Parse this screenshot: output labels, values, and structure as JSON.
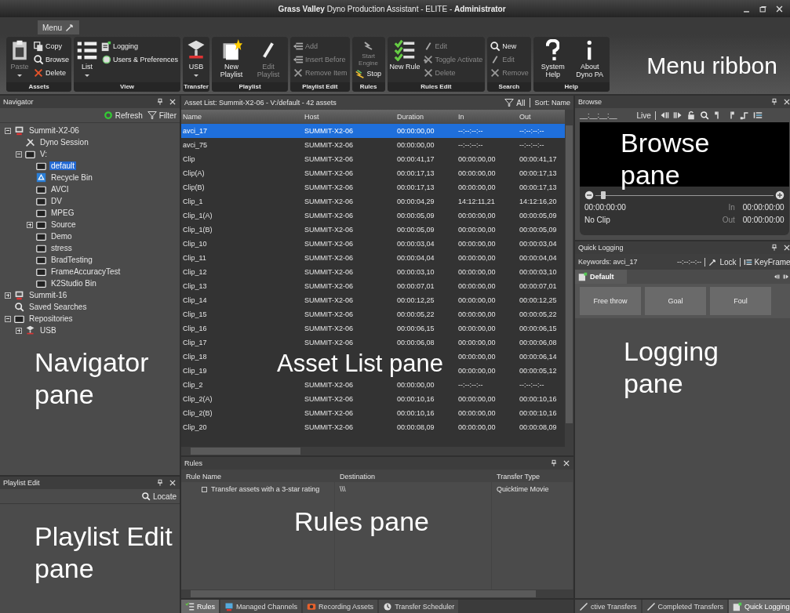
{
  "window": {
    "title": "**Grass Valley** Dyno Production Assistant - ELITE - **Administrator**"
  },
  "menu_tab": {
    "label": "Menu"
  },
  "ribbon": {
    "groups": [
      {
        "label": "Assets",
        "items": [
          {
            "label": "Paste",
            "kind": "large",
            "disabled": true,
            "dropdown": true
          },
          {
            "label": "Copy",
            "kind": "small",
            "disabled": false
          },
          {
            "label": "Browse",
            "kind": "small",
            "disabled": false
          },
          {
            "label": "Delete",
            "kind": "small",
            "disabled": false
          }
        ]
      },
      {
        "label": "View",
        "items": [
          {
            "label": "List",
            "kind": "large",
            "disabled": false,
            "dropdown": true
          },
          {
            "label": "Logging",
            "kind": "small",
            "disabled": false
          },
          {
            "label": "Users & Preferences",
            "kind": "small",
            "disabled": false
          }
        ]
      },
      {
        "label": "Transfer",
        "items": [
          {
            "label": "USB",
            "kind": "large",
            "disabled": false,
            "dropdown": true
          }
        ]
      },
      {
        "label": "Playlist",
        "items": [
          {
            "label": "New Playlist",
            "kind": "large",
            "disabled": false
          },
          {
            "label": "Edit Playlist",
            "kind": "large",
            "disabled": true
          }
        ]
      },
      {
        "label": "Playlist Edit",
        "items": [
          {
            "label": "Add",
            "kind": "small",
            "disabled": true
          },
          {
            "label": "Insert Before",
            "kind": "small",
            "disabled": true
          },
          {
            "label": "Remove Item",
            "kind": "small",
            "disabled": true
          }
        ]
      },
      {
        "label": "Rules",
        "items": [
          {
            "label": "Start Engine",
            "kind": "medium",
            "disabled": true
          },
          {
            "label": "Stop",
            "kind": "small",
            "disabled": false
          }
        ]
      },
      {
        "label": "Rules Edit",
        "items": [
          {
            "label": "New Rule",
            "kind": "large",
            "disabled": false
          },
          {
            "label": "Edit",
            "kind": "small",
            "disabled": true
          },
          {
            "label": "Toggle Activate",
            "kind": "small",
            "disabled": true
          },
          {
            "label": "Delete",
            "kind": "small",
            "disabled": true
          }
        ]
      },
      {
        "label": "Search",
        "items": [
          {
            "label": "New",
            "kind": "small",
            "disabled": false
          },
          {
            "label": "Edit",
            "kind": "small",
            "disabled": true
          },
          {
            "label": "Remove",
            "kind": "small",
            "disabled": true
          }
        ]
      },
      {
        "label": "Help",
        "items": [
          {
            "label": "System Help",
            "kind": "large",
            "disabled": false
          },
          {
            "label": "About Dyno PA",
            "kind": "large",
            "disabled": false
          }
        ]
      }
    ],
    "annotation": "Menu ribbon"
  },
  "navigator": {
    "title": "Navigator",
    "toolbar": [
      "Refresh",
      "Filter"
    ],
    "tree": [
      {
        "label": "Summit-X2-06",
        "expanded": true,
        "selected": false,
        "children": [
          {
            "label": "Dyno Session",
            "selected": false
          },
          {
            "label": "V:",
            "expanded": true,
            "selected": false,
            "children": [
              {
                "label": "default",
                "selected": true
              },
              {
                "label": "Recycle Bin",
                "selected": false
              },
              {
                "label": "AVCI",
                "selected": false
              },
              {
                "label": "DV",
                "selected": false
              },
              {
                "label": "MPEG",
                "selected": false
              },
              {
                "label": "Source",
                "expanded": false,
                "selected": false
              },
              {
                "label": "Demo",
                "selected": false
              },
              {
                "label": "stress",
                "selected": false
              },
              {
                "label": "BradTesting",
                "selected": false
              },
              {
                "label": "FrameAccuracyTest",
                "selected": false
              },
              {
                "label": "K2Studio Bin",
                "selected": false
              }
            ]
          }
        ]
      },
      {
        "label": "Summit-16",
        "expanded": false,
        "selected": false
      },
      {
        "label": "Saved Searches",
        "selected": false
      },
      {
        "label": "Repositories",
        "expanded": true,
        "selected": false,
        "children": [
          {
            "label": "USB",
            "expanded": false,
            "selected": false
          }
        ]
      }
    ],
    "annotation": "Navigator pane"
  },
  "playlist_edit": {
    "title": "Playlist Edit",
    "toolbar": [
      "Locate"
    ],
    "annotation": "Playlist Edit pane"
  },
  "asset_list": {
    "title": "Asset List: Summit-X2-06 - V:/default - 42 assets",
    "filter": "All",
    "sort": "Sort: Name",
    "columns": [
      "Name",
      "Host",
      "Duration",
      "In",
      "Out"
    ],
    "rows": [
      {
        "cells": [
          "avci_17",
          "SUMMIT-X2-06",
          "00:00:00,00",
          "--:--:--:--",
          "--:--:--:--"
        ],
        "selected": true
      },
      {
        "cells": [
          "avci_75",
          "SUMMIT-X2-06",
          "00:00:00,00",
          "--:--:--:--",
          "--:--:--:--"
        ],
        "selected": false
      },
      {
        "cells": [
          "Clip",
          "SUMMIT-X2-06",
          "00:00:41,17",
          "00:00:00,00",
          "00:00:41,17"
        ],
        "selected": false
      },
      {
        "cells": [
          "Clip(A)",
          "SUMMIT-X2-06",
          "00:00:17,13",
          "00:00:00,00",
          "00:00:17,13"
        ],
        "selected": false
      },
      {
        "cells": [
          "Clip(B)",
          "SUMMIT-X2-06",
          "00:00:17,13",
          "00:00:00,00",
          "00:00:17,13"
        ],
        "selected": false
      },
      {
        "cells": [
          "Clip_1",
          "SUMMIT-X2-06",
          "00:00:04,29",
          "14:12:11,21",
          "14:12:16,20"
        ],
        "selected": false
      },
      {
        "cells": [
          "Clip_1(A)",
          "SUMMIT-X2-06",
          "00:00:05,09",
          "00:00:00,00",
          "00:00:05,09"
        ],
        "selected": false
      },
      {
        "cells": [
          "Clip_1(B)",
          "SUMMIT-X2-06",
          "00:00:05,09",
          "00:00:00,00",
          "00:00:05,09"
        ],
        "selected": false
      },
      {
        "cells": [
          "Clip_10",
          "SUMMIT-X2-06",
          "00:00:03,04",
          "00:00:00,00",
          "00:00:03,04"
        ],
        "selected": false
      },
      {
        "cells": [
          "Clip_11",
          "SUMMIT-X2-06",
          "00:00:04,04",
          "00:00:00,00",
          "00:00:04,04"
        ],
        "selected": false
      },
      {
        "cells": [
          "Clip_12",
          "SUMMIT-X2-06",
          "00:00:03,10",
          "00:00:00,00",
          "00:00:03,10"
        ],
        "selected": false
      },
      {
        "cells": [
          "Clip_13",
          "SUMMIT-X2-06",
          "00:00:07,01",
          "00:00:00,00",
          "00:00:07,01"
        ],
        "selected": false
      },
      {
        "cells": [
          "Clip_14",
          "SUMMIT-X2-06",
          "00:00:12,25",
          "00:00:00,00",
          "00:00:12,25"
        ],
        "selected": false
      },
      {
        "cells": [
          "Clip_15",
          "SUMMIT-X2-06",
          "00:00:05,22",
          "00:00:00,00",
          "00:00:05,22"
        ],
        "selected": false
      },
      {
        "cells": [
          "Clip_16",
          "SUMMIT-X2-06",
          "00:00:06,15",
          "00:00:00,00",
          "00:00:06,15"
        ],
        "selected": false
      },
      {
        "cells": [
          "Clip_17",
          "SUMMIT-X2-06",
          "00:00:06,08",
          "00:00:00,00",
          "00:00:06,08"
        ],
        "selected": false
      },
      {
        "cells": [
          "Clip_18",
          null,
          null,
          "00:00:00,00",
          "00:00:06,14"
        ],
        "selected": false
      },
      {
        "cells": [
          "Clip_19",
          null,
          null,
          "00:00:00,00",
          "00:00:05,12"
        ],
        "selected": false
      },
      {
        "cells": [
          "Clip_2",
          "SUMMIT-X2-06",
          "00:00:00,00",
          "--:--:--:--",
          "--:--:--:--"
        ],
        "selected": false
      },
      {
        "cells": [
          "Clip_2(A)",
          "SUMMIT-X2-06",
          "00:00:10,16",
          "00:00:00,00",
          "00:00:10,16"
        ],
        "selected": false
      },
      {
        "cells": [
          "Clip_2(B)",
          "SUMMIT-X2-06",
          "00:00:10,16",
          "00:00:00,00",
          "00:00:10,16"
        ],
        "selected": false
      },
      {
        "cells": [
          "Clip_20",
          "SUMMIT-X2-06",
          "00:00:08,09",
          "00:00:00,00",
          "00:00:08,09"
        ],
        "selected": false
      }
    ],
    "annotation": "Asset List pane"
  },
  "rules": {
    "title": "Rules",
    "columns": [
      "Rule Name",
      "Destination",
      "Transfer Type"
    ],
    "rows": [
      {
        "checked": false,
        "cells": [
          "Transfer assets with a 3-star rating",
          "\\\\\\",
          "Quicktime Movie"
        ]
      }
    ],
    "annotation": "Rules pane"
  },
  "bottom_tabs_left": [
    {
      "label": "Rules",
      "selected": true
    },
    {
      "label": "Managed Channels",
      "selected": false
    },
    {
      "label": "Recording Assets",
      "selected": false
    },
    {
      "label": "Transfer Scheduler",
      "selected": false
    }
  ],
  "browse": {
    "title": "Browse",
    "timecode_field": "__:__:__:__",
    "live": "Live",
    "annotation": "Browse pane",
    "slider": {
      "level": 0.03
    },
    "position": "00:00:00:00",
    "clip": "No Clip",
    "in_label": "In",
    "in_value": "00:00:00:00",
    "out_label": "Out",
    "out_value": "00:00:00:00"
  },
  "quick_logging": {
    "title": "Quick Logging",
    "keywords": "Keywords: avci_17",
    "timecode": "--:--:--:--",
    "lock": "Lock",
    "keyframe": "KeyFrame",
    "tabs": [
      {
        "label": "Default",
        "selected": true
      }
    ],
    "buttons": [
      "Free throw",
      "Goal",
      "Foul"
    ],
    "annotation": "Logging pane"
  },
  "bottom_tabs_right": [
    {
      "label": "ctive Transfers",
      "selected": false
    },
    {
      "label": "Completed Transfers",
      "selected": false
    },
    {
      "label": "Quick Logging",
      "selected": true
    }
  ]
}
